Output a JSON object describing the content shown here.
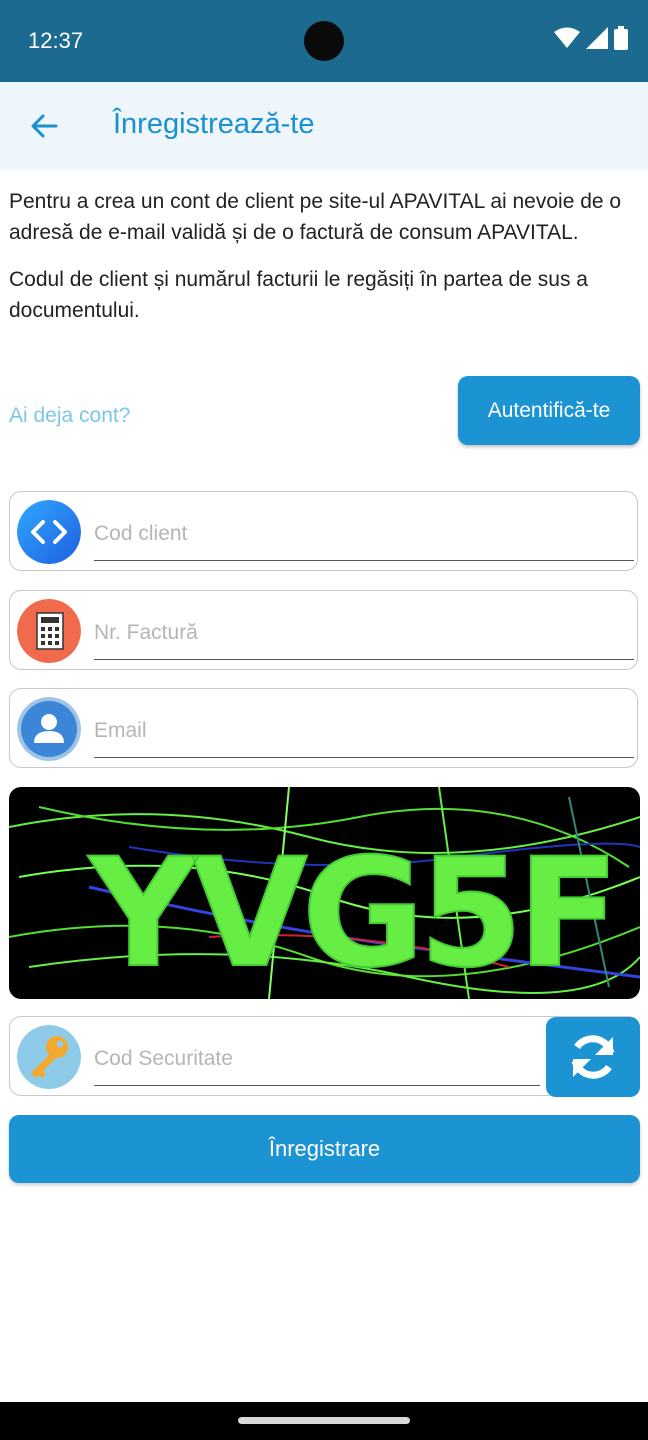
{
  "status_bar": {
    "time": "12:37"
  },
  "app_bar": {
    "title": "Înregistrează-te",
    "back_icon": "arrow-left-icon"
  },
  "intro": {
    "paragraph1": "Pentru a crea un cont de client pe site-ul APAVITAL ai nevoie de o adresă de e-mail validă și de o factură de consum APAVITAL.",
    "paragraph2": "Codul de client și numărul facturii le regăsiți în partea de sus a documentului."
  },
  "login": {
    "prompt": "Ai deja cont?",
    "button_label": "Autentifică-te"
  },
  "form": {
    "client_code": {
      "placeholder": "Cod client",
      "value": "",
      "icon": "code-brackets-icon"
    },
    "invoice_number": {
      "placeholder": "Nr. Factură",
      "value": "",
      "icon": "calculator-icon"
    },
    "email": {
      "placeholder": "Email",
      "value": "",
      "icon": "user-avatar-icon"
    },
    "captcha": {
      "text": "YVG5F"
    },
    "security_code": {
      "placeholder": "Cod Securitate",
      "value": "",
      "icon": "key-icon"
    },
    "refresh_icon": "refresh-icon",
    "submit_label": "Înregistrare"
  },
  "colors": {
    "primary": "#1c93d3",
    "status_bar": "#1c6a90",
    "app_bar_bg": "#eef6fc",
    "link": "#7cc6ea"
  }
}
